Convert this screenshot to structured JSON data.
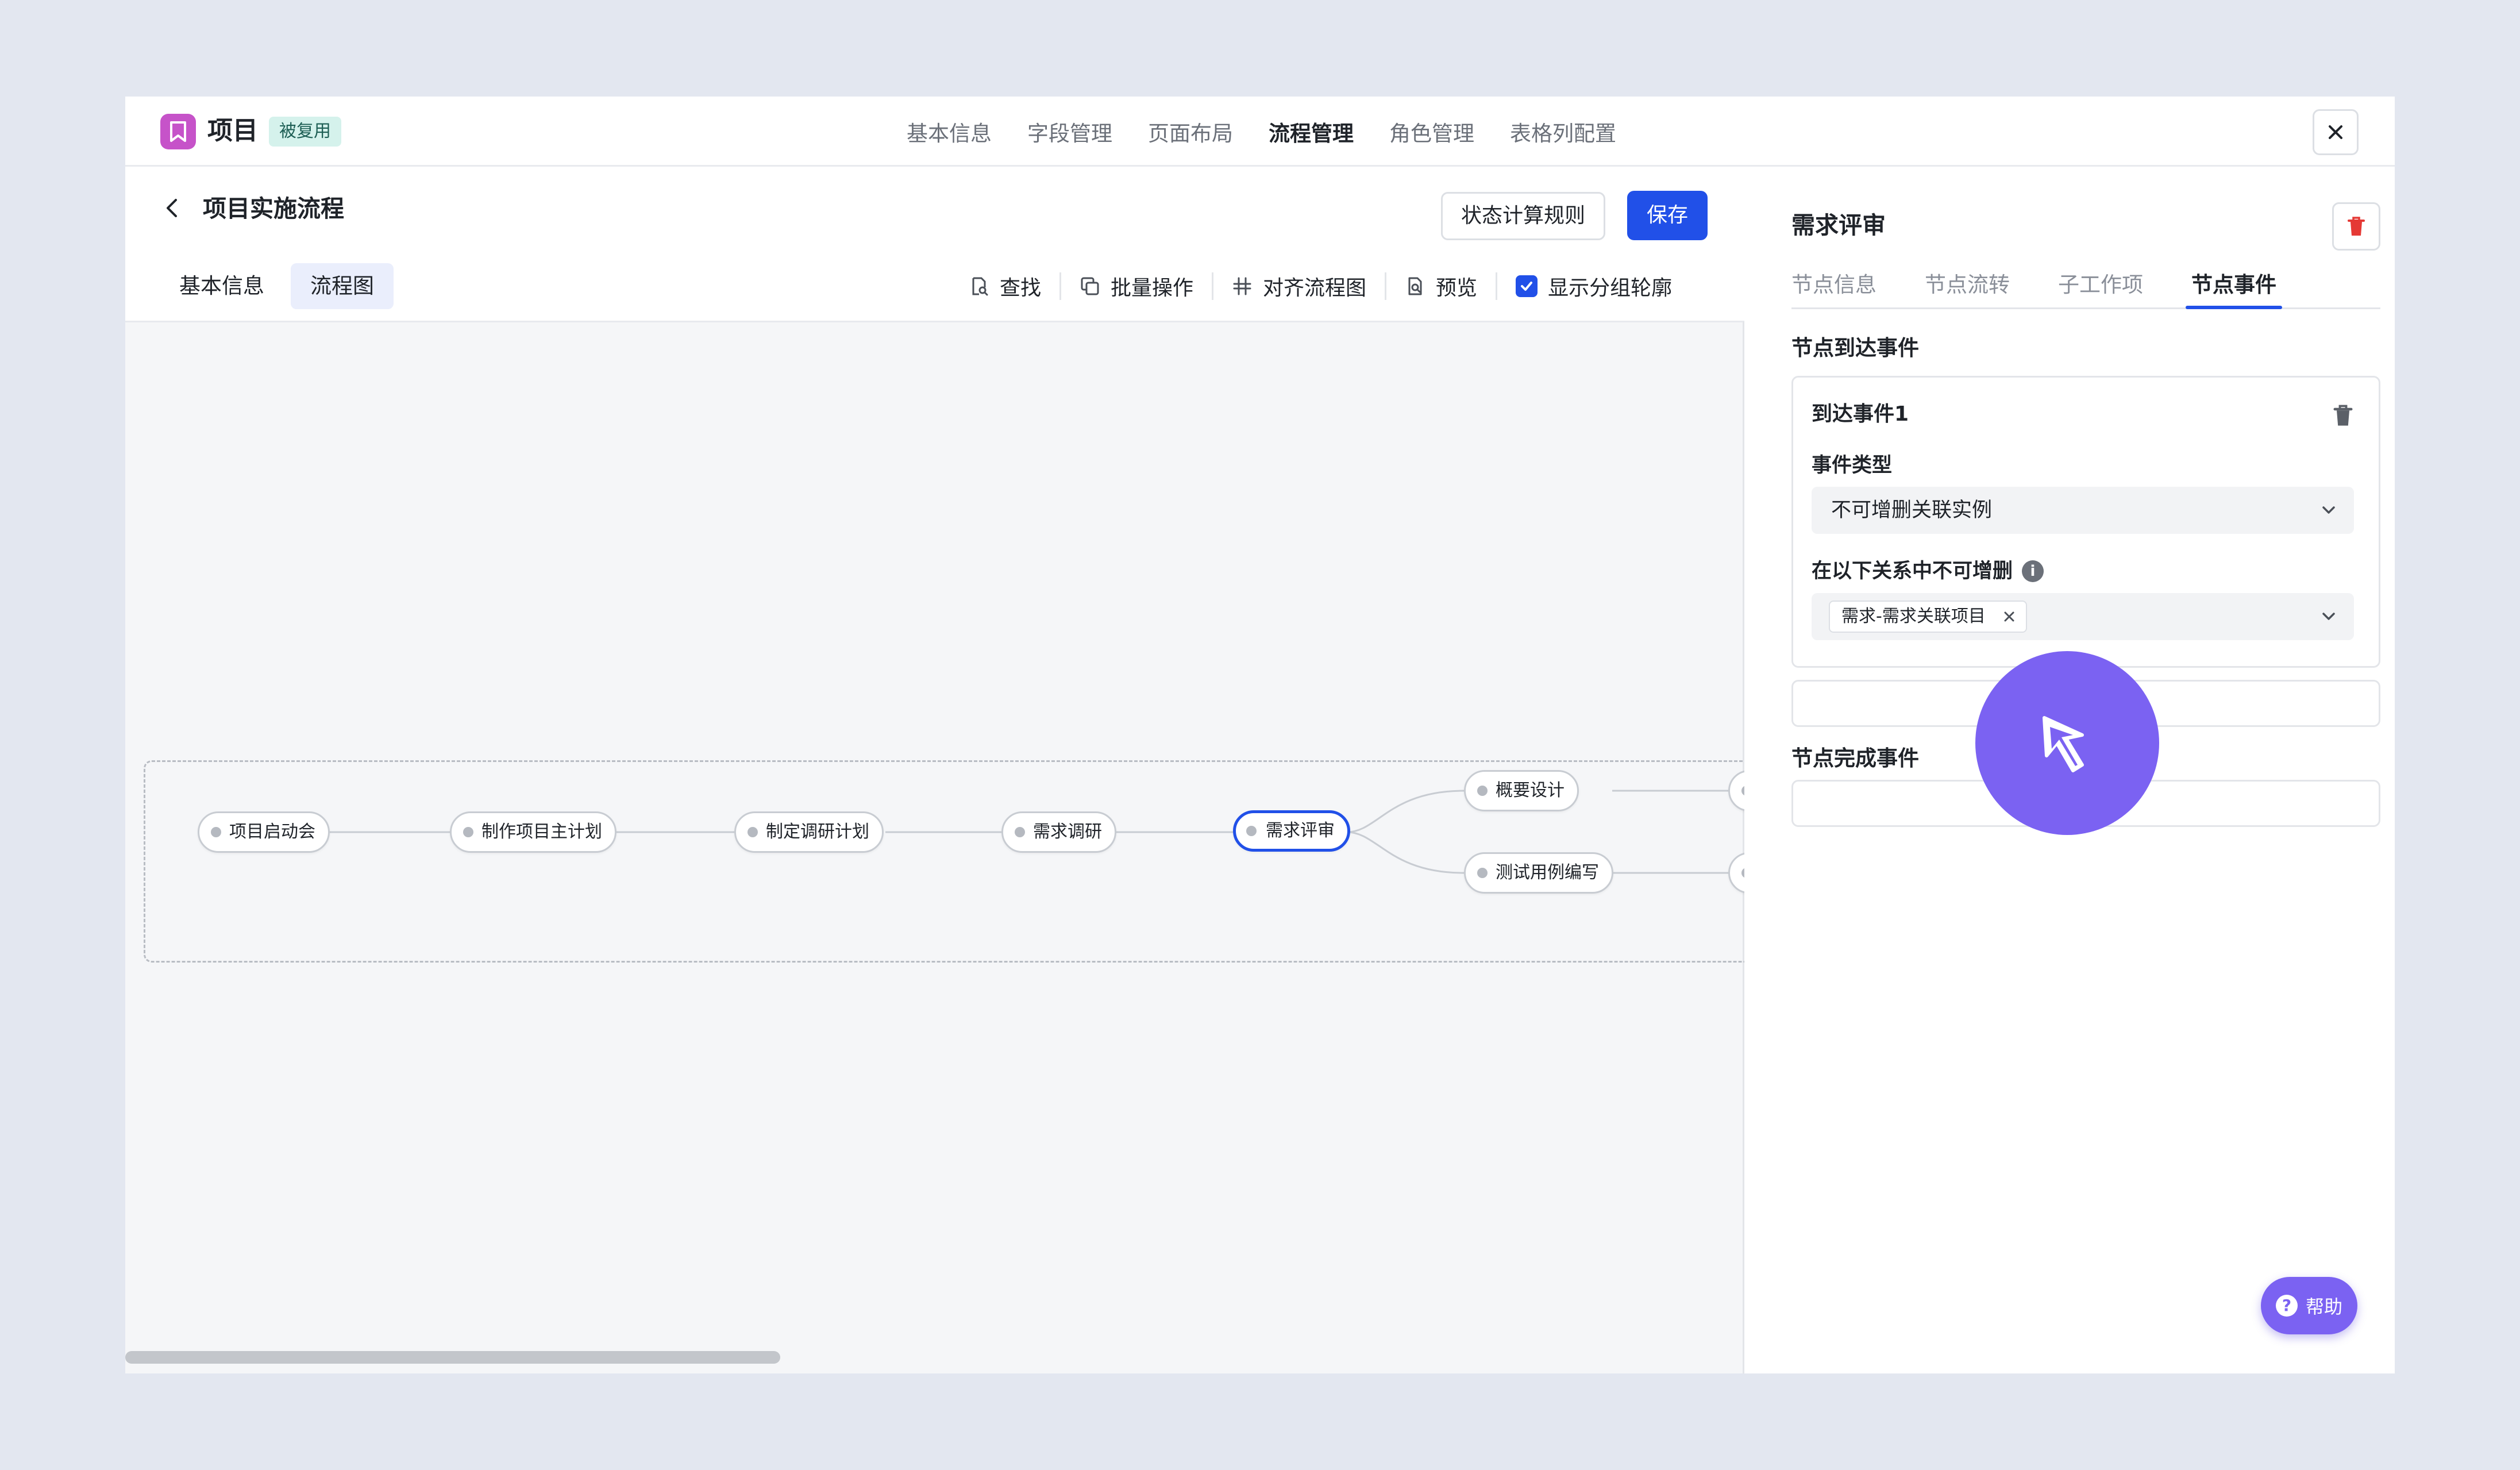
{
  "app": {
    "title": "项目",
    "badge": "被复用"
  },
  "top_tabs": [
    "基本信息",
    "字段管理",
    "页面布局",
    "流程管理",
    "角色管理",
    "表格列配置"
  ],
  "flow": {
    "title": "项目实施流程",
    "rule_button": "状态计算规则",
    "save_button": "保存",
    "sub_tabs": [
      "基本信息",
      "流程图"
    ],
    "toolbar": {
      "find": "查找",
      "batch": "批量操作",
      "align": "对齐流程图",
      "preview": "预览",
      "show_outline": "显示分组轮廓",
      "show_outline_checked": true
    },
    "nodes": [
      "项目启动会",
      "制作项目主计划",
      "制定调研计划",
      "需求调研",
      "需求评审",
      "概要设计",
      "测试用例编写"
    ],
    "active_node": "需求评审"
  },
  "panel": {
    "title": "需求评审",
    "tabs": [
      "节点信息",
      "节点流转",
      "子工作项",
      "节点事件"
    ],
    "active_tab": "节点事件",
    "arrival_section": "节点到达事件",
    "event": {
      "name": "到达事件1",
      "type_label": "事件类型",
      "type_value": "不可增删关联实例",
      "relation_label": "在以下关系中不可增删",
      "relation_tag": "需求-需求关联项目"
    },
    "complete_section": "节点完成事件"
  },
  "help": {
    "label": "帮助"
  },
  "colors": {
    "accent": "#2150e8",
    "brand": "#c653c9",
    "cursor": "#7b62f2",
    "danger": "#e53935"
  },
  "icons": [
    "bookmark-icon",
    "close-icon",
    "chevron-left-icon",
    "search-doc-icon",
    "copy-icon",
    "align-icon",
    "preview-icon",
    "check-icon",
    "trash-icon",
    "chevron-down-icon",
    "info-icon",
    "help-icon",
    "cursor-arrow-icon"
  ]
}
